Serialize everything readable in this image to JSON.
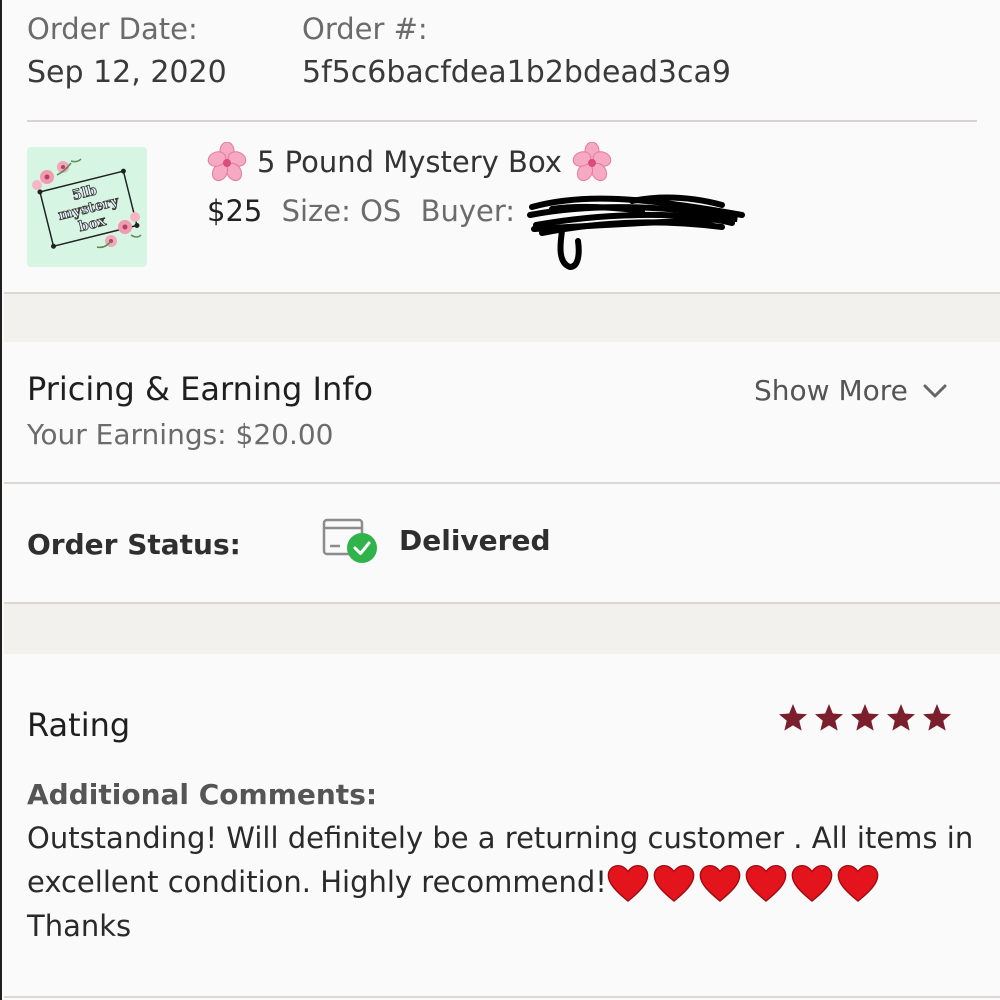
{
  "order": {
    "date_label": "Order Date:",
    "date_value": "Sep 12, 2020",
    "number_label": "Order #:",
    "number_value": "5f5c6bacfdea1b2bdead3ca9"
  },
  "product": {
    "thumbnail_text": [
      "5lb",
      "mystery",
      "box"
    ],
    "title": "5 Pound Mystery Box",
    "price": "$25",
    "size": "Size: OS",
    "buyer_label": "Buyer:"
  },
  "pricing": {
    "heading": "Pricing & Earning Info",
    "earnings": "Your Earnings: $20.00",
    "show_more": "Show More"
  },
  "status": {
    "label": "Order Status:",
    "value": "Delivered"
  },
  "rating": {
    "heading": "Rating",
    "stars": 5,
    "comments_label": "Additional Comments:",
    "comment_line1": "Outstanding! Will definitely be a returning customer . All items in",
    "comment_line2": "excellent condition. Highly recommend!",
    "comment_line3": "Thanks",
    "hearts": 6
  },
  "colors": {
    "star": "#7a1f2b",
    "heart": "#e3141b",
    "check": "#2fb34a",
    "thumb_bg": "#d7f5e3"
  },
  "icons": [
    "flower-icon",
    "package-delivered-icon",
    "chevron-down-icon",
    "star-icon",
    "heart-icon"
  ]
}
